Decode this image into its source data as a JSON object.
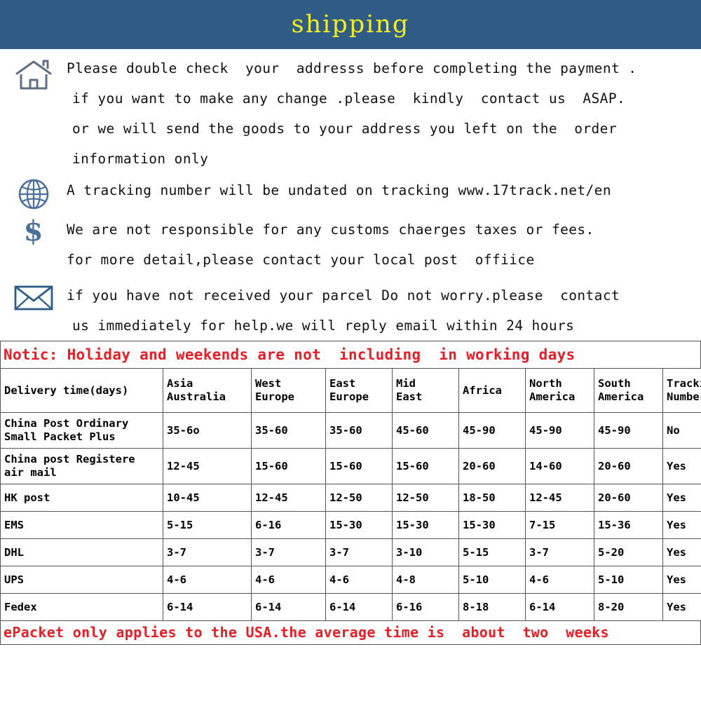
{
  "banner": {
    "title": "shipping",
    "bg_color": "#2f5b87",
    "text_color": "#f5ee1e"
  },
  "info_blocks": [
    {
      "icon": "house-icon",
      "lines": [
        "Please double check  your  addresss before completing the payment .",
        "if you want to make any change .please  kindly  contact us  ASAP.",
        "or we will send the goods to your address you left on the  order",
        "information only"
      ]
    },
    {
      "icon": "globe-icon",
      "lines": [
        "A tracking number will be undated on tracking www.17track.net/en"
      ]
    },
    {
      "icon": "dollar-icon",
      "lines": [
        "We are not responsible for any customs chaerges taxes or fees.",
        "for more detail,please contact your local post  offiice"
      ]
    },
    {
      "icon": "envelope-icon",
      "lines": [
        "if you have not received your parcel Do not worry.please  contact",
        "us immediately for help.we will reply email within 24 hours"
      ]
    }
  ],
  "notice": {
    "text": "Notic: Holiday and weekends are not  including  in working days",
    "color": "#ec1c24"
  },
  "table": {
    "headers": [
      "Delivery time(days)",
      "Asia\nAustralia",
      "West\nEurope",
      "East\nEurope",
      "Mid\nEast",
      "Africa",
      "North\nAmerica",
      "South\nAmerica",
      "Tracking\nNumber"
    ],
    "rows": [
      {
        "method": "China Post Ordinary\nSmall Packet Plus",
        "tall": true,
        "cells": [
          "35-6o",
          "35-60",
          "35-60",
          "45-60",
          "45-90",
          "45-90",
          "45-90",
          "No"
        ]
      },
      {
        "method": "China post Registere\nair mail",
        "tall": true,
        "cells": [
          "12-45",
          "15-60",
          "15-60",
          "15-60",
          "20-60",
          "14-60",
          "20-60",
          "Yes"
        ]
      },
      {
        "method": "HK post",
        "tall": false,
        "cells": [
          "10-45",
          "12-45",
          "12-50",
          "12-50",
          "18-50",
          "12-45",
          "20-60",
          "Yes"
        ]
      },
      {
        "method": "EMS",
        "tall": false,
        "cells": [
          "5-15",
          "6-16",
          "15-30",
          "15-30",
          "15-30",
          "7-15",
          "15-36",
          "Yes"
        ]
      },
      {
        "method": "DHL",
        "tall": false,
        "cells": [
          "3-7",
          "3-7",
          "3-7",
          "3-10",
          "5-15",
          "3-7",
          "5-20",
          "Yes"
        ]
      },
      {
        "method": "UPS",
        "tall": false,
        "cells": [
          "4-6",
          "4-6",
          "4-6",
          "4-8",
          "5-10",
          "4-6",
          "5-10",
          "Yes"
        ]
      },
      {
        "method": "Fedex",
        "tall": false,
        "cells": [
          "6-14",
          "6-14",
          "6-14",
          "6-16",
          "8-18",
          "6-14",
          "8-20",
          "Yes"
        ]
      }
    ]
  },
  "footer_note": {
    "text": "ePacket only applies to the USA.the average time is  about  two  weeks",
    "color": "#ec1c24"
  }
}
